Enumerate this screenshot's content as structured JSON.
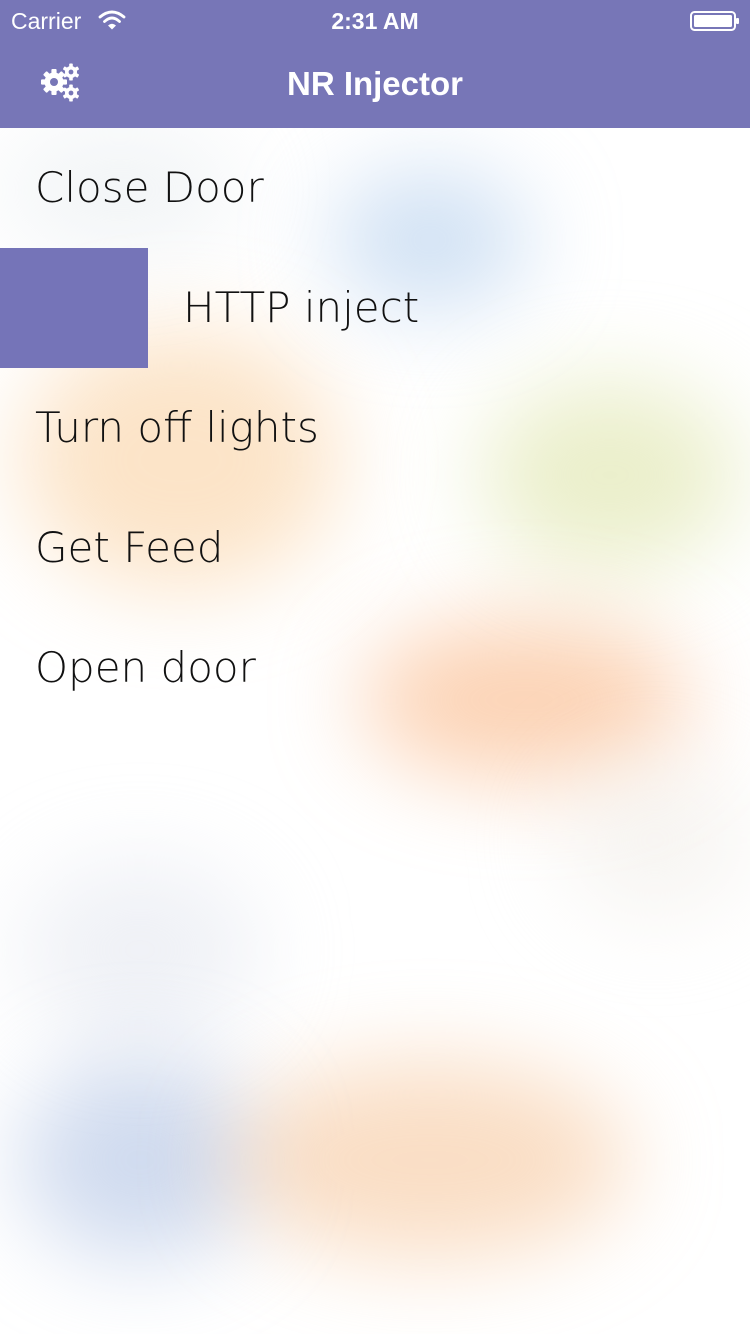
{
  "status_bar": {
    "carrier": "Carrier",
    "time": "2:31 AM",
    "wifi_icon": "wifi-icon",
    "battery_icon": "battery-icon"
  },
  "nav": {
    "title": "NR Injector",
    "settings_icon": "gears-icon",
    "color": "#7776b7"
  },
  "items": [
    {
      "label": "Close Door"
    },
    {
      "label": "HTTP inject",
      "active": true
    },
    {
      "label": "Turn off lights"
    },
    {
      "label": "Get Feed"
    },
    {
      "label": "Open door"
    }
  ],
  "colors": {
    "accent": "#7574b8",
    "text": "#111111"
  }
}
